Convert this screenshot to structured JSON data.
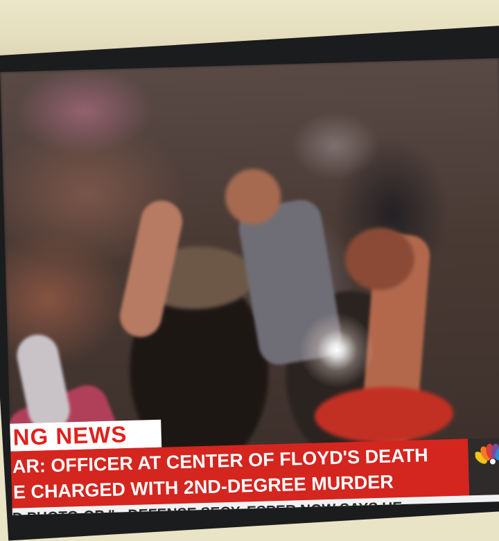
{
  "scene": {
    "subject": "crowd-with-raised-fists"
  },
  "lower_third": {
    "tab_label": "NG NEWS",
    "headline_line1": "AR: OFFICER AT CENTER OF FLOYD'S DEATH",
    "headline_line2": "E CHARGED WITH 2ND-DEGREE MURDER",
    "ticker": "D PHOTO-OP \" - DEFENSE SECY. ESPER NOW SAYS HE",
    "colors": {
      "banner_red": "#d4251f",
      "tab_text": "#e0211d",
      "ticker_bg": "#f2f2f2"
    }
  },
  "logo": {
    "icon": "nbc-peacock-icon"
  }
}
